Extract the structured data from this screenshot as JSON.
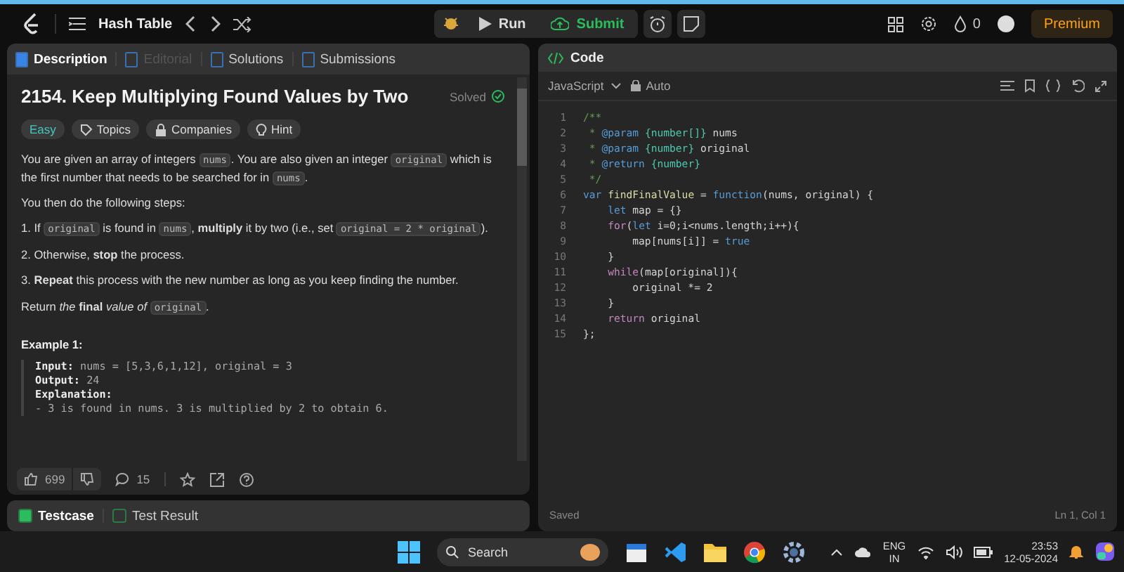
{
  "topbar": {
    "problem_list": "Hash Table",
    "run": "Run",
    "submit": "Submit",
    "streak": "0",
    "premium": "Premium"
  },
  "left_tabs": [
    {
      "label": "Description",
      "selected": true,
      "disabled": false
    },
    {
      "label": "Editorial",
      "selected": false,
      "disabled": true
    },
    {
      "label": "Solutions",
      "selected": false,
      "disabled": false
    },
    {
      "label": "Submissions",
      "selected": false,
      "disabled": false
    }
  ],
  "problem": {
    "title": "2154. Keep Multiplying Found Values by Two",
    "status": "Solved",
    "tags": [
      {
        "kind": "difficulty",
        "label": "Easy"
      },
      {
        "kind": "topics",
        "label": "Topics"
      },
      {
        "kind": "companies",
        "label": "Companies"
      },
      {
        "kind": "hint",
        "label": "Hint"
      }
    ],
    "paragraphs": [
      [
        {
          "kind": "text",
          "text": "You are given an array of integers "
        },
        {
          "kind": "code",
          "text": "nums"
        },
        {
          "kind": "text",
          "text": ". You are also given an integer "
        },
        {
          "kind": "code",
          "text": "original"
        },
        {
          "kind": "text",
          "text": " which is the first number that needs to be searched for in "
        },
        {
          "kind": "code",
          "text": "nums"
        },
        {
          "kind": "text",
          "text": "."
        }
      ],
      [
        {
          "kind": "text",
          "text": "You then do the following steps:"
        }
      ],
      [
        {
          "kind": "text",
          "text": "1. If "
        },
        {
          "kind": "code",
          "text": "original"
        },
        {
          "kind": "text",
          "text": " is found in "
        },
        {
          "kind": "code",
          "text": "nums"
        },
        {
          "kind": "text",
          "text": ", **multiply** it by two (i.e., set "
        },
        {
          "kind": "code",
          "text": "original = 2 * original"
        },
        {
          "kind": "text",
          "text": ")."
        }
      ],
      [
        {
          "kind": "text",
          "text": "2. Otherwise, **stop** the process."
        }
      ],
      [
        {
          "kind": "text",
          "text": "3. **Repeat** this process with the new number as long as you keep finding the number."
        }
      ],
      [
        {
          "kind": "text",
          "text": "Return *the* **final** *value of* "
        },
        {
          "kind": "code",
          "text": "original"
        },
        {
          "kind": "text",
          "text": "."
        }
      ]
    ],
    "example_title": "Example 1:",
    "example_lines": [
      {
        "label": "Input:",
        "text": "nums = [5,3,6,1,12], original = 3"
      },
      {
        "label": "Output:",
        "text": "24"
      },
      {
        "label": "Explanation:"
      },
      {
        "text": "- 3 is found in nums. 3 is multiplied by 2 to obtain 6."
      }
    ]
  },
  "footer": {
    "likes": "699",
    "comments": "15"
  },
  "bottom_tabs": [
    {
      "label": "Testcase",
      "selected": true
    },
    {
      "label": "Test Result",
      "selected": false
    }
  ],
  "code": {
    "title": "Code",
    "language": "JavaScript",
    "mode": "Auto",
    "status": "Saved",
    "cursor": "Ln 1, Col 1",
    "line_numbers": [
      "1",
      "2",
      "3",
      "4",
      "5",
      "6",
      "7",
      "8",
      "9",
      "10",
      "11",
      "12",
      "13",
      "14",
      "15"
    ],
    "lines": [
      [
        {
          "kind": "comment",
          "text": "/**"
        }
      ],
      [
        {
          "kind": "comment",
          "text": " * "
        },
        {
          "kind": "tag",
          "text": "@param"
        },
        {
          "kind": "type",
          "text": " {number[]}"
        },
        {
          "kind": "plain",
          "text": " nums"
        }
      ],
      [
        {
          "kind": "comment",
          "text": " * "
        },
        {
          "kind": "tag",
          "text": "@param"
        },
        {
          "kind": "type",
          "text": " {number}"
        },
        {
          "kind": "plain",
          "text": " original"
        }
      ],
      [
        {
          "kind": "comment",
          "text": " * "
        },
        {
          "kind": "tag",
          "text": "@return"
        },
        {
          "kind": "type",
          "text": " {number}"
        }
      ],
      [
        {
          "kind": "comment",
          "text": " */"
        }
      ],
      [
        {
          "kind": "keyword",
          "text": "var "
        },
        {
          "kind": "func",
          "text": "findFinalValue"
        },
        {
          "kind": "plain",
          "text": " = "
        },
        {
          "kind": "keyword",
          "text": "function"
        },
        {
          "kind": "plain",
          "text": "(nums, original) {"
        }
      ],
      [
        {
          "kind": "keyword",
          "text": "    let "
        },
        {
          "kind": "plain",
          "text": "map = {}"
        }
      ],
      [
        {
          "kind": "control",
          "text": "    for"
        },
        {
          "kind": "plain",
          "text": "("
        },
        {
          "kind": "keyword",
          "text": "let "
        },
        {
          "kind": "plain",
          "text": "i=0;i<nums.length;i++){"
        }
      ],
      [
        {
          "kind": "plain",
          "text": "        map[nums[i]] = "
        },
        {
          "kind": "keyword",
          "text": "true"
        }
      ],
      [
        {
          "kind": "plain",
          "text": "    }"
        }
      ],
      [
        {
          "kind": "control",
          "text": "    while"
        },
        {
          "kind": "plain",
          "text": "(map[original]){"
        }
      ],
      [
        {
          "kind": "plain",
          "text": "        original *= 2"
        }
      ],
      [
        {
          "kind": "plain",
          "text": "    }"
        }
      ],
      [
        {
          "kind": "control",
          "text": "    return"
        },
        {
          "kind": "plain",
          "text": " original"
        }
      ],
      [
        {
          "kind": "plain",
          "text": "};"
        }
      ]
    ]
  },
  "taskbar": {
    "search": "Search",
    "lang": "ENG",
    "region": "IN",
    "time": "23:53",
    "date": "12-05-2024"
  }
}
